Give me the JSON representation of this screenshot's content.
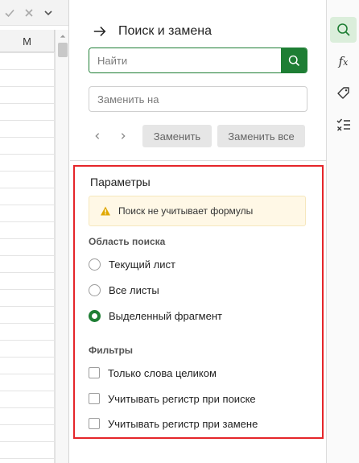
{
  "sheet": {
    "column_header": "M",
    "toolbar_icons": [
      "check-icon",
      "close-icon",
      "chevron-down-icon"
    ]
  },
  "panel": {
    "title": "Поиск и замена",
    "find": {
      "placeholder": "Найти",
      "value": ""
    },
    "replace": {
      "placeholder": "Заменить на",
      "value": ""
    },
    "replace_button": "Заменить",
    "replace_all_button": "Заменить все"
  },
  "params": {
    "title": "Параметры",
    "warning": "Поиск не учитывает формулы",
    "scope_label": "Область поиска",
    "scope_options": [
      {
        "label": "Текущий лист",
        "checked": false
      },
      {
        "label": "Все листы",
        "checked": false
      },
      {
        "label": "Выделенный фрагмент",
        "checked": true
      }
    ],
    "filters_label": "Фильтры",
    "filters": [
      {
        "label": "Только слова целиком",
        "checked": false
      },
      {
        "label": "Учитывать регистр при поиске",
        "checked": false
      },
      {
        "label": "Учитывать регистр при замене",
        "checked": false
      }
    ]
  },
  "rail": {
    "items": [
      "search-icon",
      "function-icon",
      "tag-icon",
      "check-list-icon"
    ],
    "active": "search-icon"
  },
  "colors": {
    "accent": "#1e7e34",
    "highlight_border": "#e5252a",
    "warning_bg": "#fff8e6",
    "warning_icon": "#e0a800"
  }
}
